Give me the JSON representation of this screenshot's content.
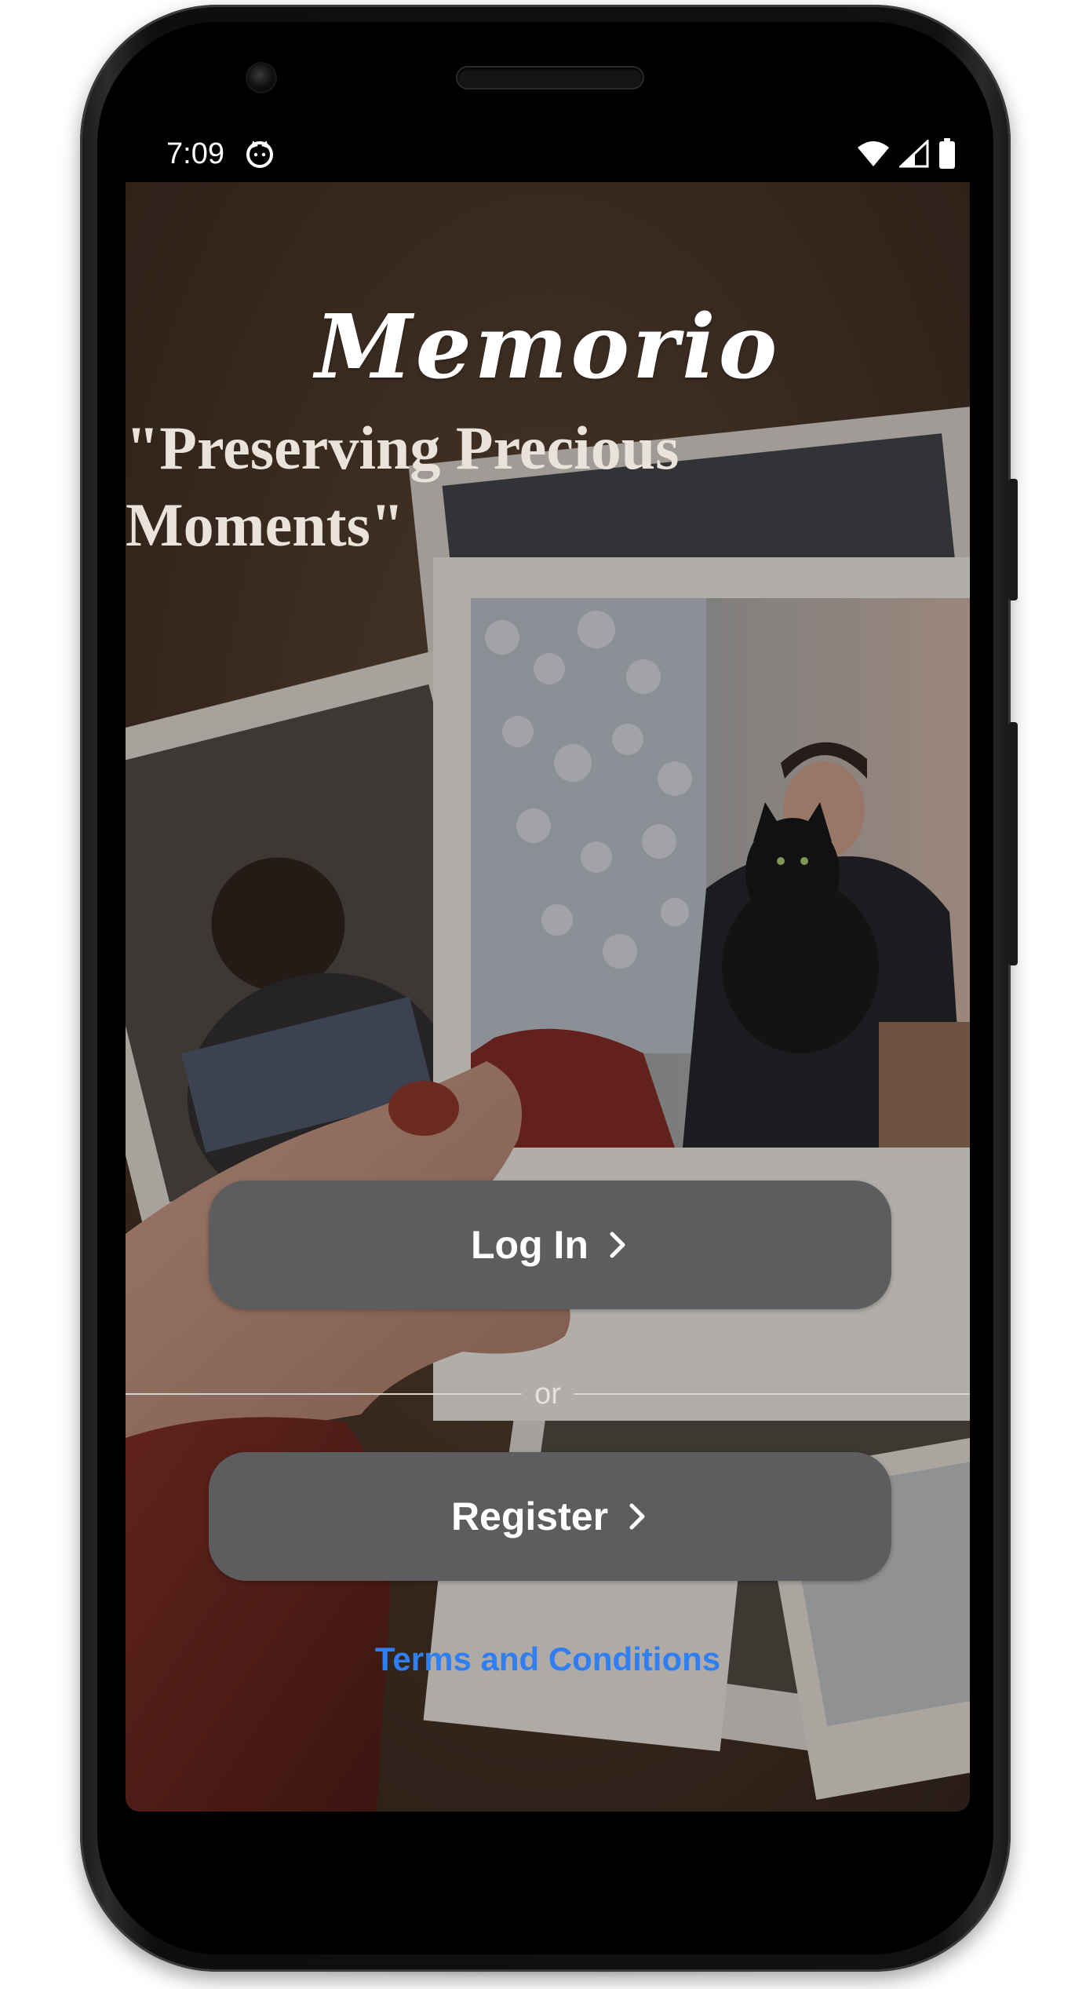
{
  "status_bar": {
    "time": "7:09",
    "icons": [
      "cat-notification-icon",
      "wifi-icon",
      "signal-icon",
      "battery-icon"
    ]
  },
  "app": {
    "title": "Memorio",
    "tagline": "\"Preserving Precious Moments\""
  },
  "actions": {
    "login_label": "Log In",
    "divider_label": "or",
    "register_label": "Register",
    "terms_label": "Terms and Conditions"
  },
  "colors": {
    "button_bg": "#5d5c5f",
    "link": "#2f7ff2",
    "text": "#ffffff"
  },
  "background_image": "polaroid-photos-held-in-hand"
}
